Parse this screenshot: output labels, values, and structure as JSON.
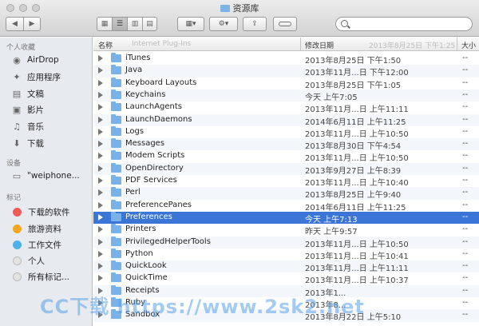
{
  "window": {
    "title": "资源库"
  },
  "toolbar": {
    "back_icon": "chevron-left-icon",
    "forward_icon": "chevron-right-icon",
    "view_modes": [
      "icon-view",
      "list-view",
      "column-view",
      "coverflow-view"
    ],
    "arrange_icon": "arrange-icon",
    "action_icon": "gear-icon",
    "share_icon": "share-icon",
    "tag_icon": "tag-icon",
    "search_placeholder": ""
  },
  "sidebar": {
    "favorites_heading": "个人收藏",
    "favorites": [
      {
        "label": "AirDrop",
        "icon": "airdrop-icon"
      },
      {
        "label": "应用程序",
        "icon": "applications-icon"
      },
      {
        "label": "文稿",
        "icon": "documents-icon"
      },
      {
        "label": "影片",
        "icon": "movies-icon"
      },
      {
        "label": "音乐",
        "icon": "music-icon"
      },
      {
        "label": "下载",
        "icon": "downloads-icon"
      }
    ],
    "devices_heading": "设备",
    "devices": [
      {
        "label": "\"weiphone...",
        "icon": "computer-icon"
      }
    ],
    "tags_heading": "标记",
    "tags": [
      {
        "label": "下载的软件",
        "color": "#f05b5b"
      },
      {
        "label": "旅游资料",
        "color": "#f5a623"
      },
      {
        "label": "工作文件",
        "color": "#4fb0e8"
      },
      {
        "label": "个人",
        "color": "#d9d9d9"
      },
      {
        "label": "所有标记...",
        "color": "#d9d9d9"
      }
    ]
  },
  "columns": {
    "name": "名称",
    "date": "修改日期",
    "size": "大小"
  },
  "ghost_text": {
    "name": "Internet Plug-Ins",
    "date": "2013年8月25日 下午1:25"
  },
  "rows": [
    {
      "name": "iTunes",
      "date": "2013年8月25日 下午1:50",
      "size": "--"
    },
    {
      "name": "Java",
      "date": "2013年11月...日 下午12:00",
      "size": "--"
    },
    {
      "name": "Keyboard Layouts",
      "date": "2013年8月25日 下午1:05",
      "size": "--"
    },
    {
      "name": "Keychains",
      "date": "今天 上午7:05",
      "size": "--"
    },
    {
      "name": "LaunchAgents",
      "date": "2013年11月...日 上午11:11",
      "size": "--"
    },
    {
      "name": "LaunchDaemons",
      "date": "2014年6月11日 上午11:25",
      "size": "--"
    },
    {
      "name": "Logs",
      "date": "2013年11月...日 上午10:50",
      "size": "--"
    },
    {
      "name": "Messages",
      "date": "2013年8月30日 下午4:54",
      "size": "--"
    },
    {
      "name": "Modem Scripts",
      "date": "2013年11月...日 上午10:50",
      "size": "--"
    },
    {
      "name": "OpenDirectory",
      "date": "2013年9月27日 上午8:39",
      "size": "--"
    },
    {
      "name": "PDF Services",
      "date": "2013年11月...日 上午10:40",
      "size": "--"
    },
    {
      "name": "Perl",
      "date": "2013年8月25日 上午9:40",
      "size": "--"
    },
    {
      "name": "PreferencePanes",
      "date": "2014年6月11日 上午11:25",
      "size": "--"
    },
    {
      "name": "Preferences",
      "date": "今天 上午7:13",
      "size": "--",
      "selected": true
    },
    {
      "name": "Printers",
      "date": "昨天 上午9:57",
      "size": "--"
    },
    {
      "name": "PrivilegedHelperTools",
      "date": "2013年11月...日 上午10:50",
      "size": "--"
    },
    {
      "name": "Python",
      "date": "2013年11月...日 上午10:41",
      "size": "--"
    },
    {
      "name": "QuickLook",
      "date": "2013年11月...日 上午11:11",
      "size": "--"
    },
    {
      "name": "QuickTime",
      "date": "2013年11月...日 上午10:37",
      "size": "--"
    },
    {
      "name": "Receipts",
      "date": "2013年1...",
      "size": "--"
    },
    {
      "name": "Ruby",
      "date": "2013年8...",
      "size": "--"
    },
    {
      "name": "Sandbox",
      "date": "2013年8月22日 上午5:10",
      "size": "--"
    }
  ],
  "watermark": "CC下载 https://www.2sk2.net",
  "colors": {
    "selection": "#3b76d6",
    "folder": "#79b2e8",
    "sidebar_bg": "#e7ebf0"
  }
}
